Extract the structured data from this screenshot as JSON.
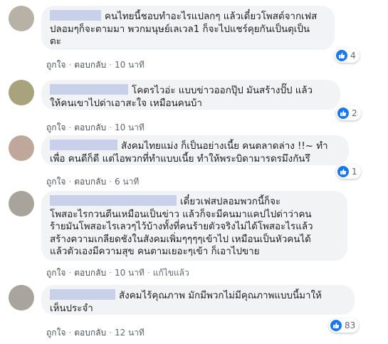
{
  "colors": {
    "like_blue": "#1877f2",
    "bubble_bg": "#f2f3f5",
    "redacted_name": "#c9d1ea"
  },
  "comments": [
    {
      "text_lines": [
        "คนไทยนี้ชอบทำอะไรแปลกๆ แล้วเดี๋ยวโพสต์จากเฟส",
        "ปลอมๆก็จะตามมา พวกมนุษย์เลเวล1 ก็จะไปแชร์คุยกันเป็นตุเป็น",
        "ตะ"
      ],
      "like_label": "ถูกใจ",
      "reply_label": "ตอบกลับ",
      "time": "10 นาที",
      "reaction_count": "4"
    },
    {
      "text_lines": [
        "โคตรไวอ่ะ แบบข่าวออกปุ๊ป มันสร้างปั๊ป แล้ว",
        "ให้คนเขาไปด่าเอาสะใจ เหมือนคนบ้า"
      ],
      "like_label": "ถูกใจ",
      "reply_label": "ตอบกลับ",
      "time": "10 นาที",
      "reaction_count": "2"
    },
    {
      "text_lines": [
        "สังคมไทยแม่ง ก็เป็นอย่างเนี้ย คนตลาดล่าง !!~ ทำ",
        "เพื่อ คนดีก็ดี แต่ไอพวกที่ทำแบบเนี้ย ทำให้พระบิดามารดรมึงกันรึ"
      ],
      "like_label": "ถูกใจ",
      "reply_label": "ตอบกลับ",
      "time": "6 นาที",
      "reaction_count": "1"
    },
    {
      "text_lines": [
        "เดี๋ยวเฟสปลอมพวกนี้ก็จะ",
        "โพสอะไรกวนตีนเหมือนเป็นข่าว แล้วก็จะมีคนมาแคปไปด่าว่าคน",
        "ร้ายมันโพสอะไรเลวๆไว้บ้างทั้งที่คนร้ายตัวจริงไม่ได้โพสอะไรแล้ว",
        "สร้างความเกลียดชังในสังคมเพิ่มๆๆๆๆเข้าไป เหมือนเป็นหัวคนได้",
        "แล้วตัวเองมีความสุข คนตามเยอะๆเข้า ก็เอาไปขาย"
      ],
      "like_label": "ถูกใจ",
      "reply_label": "ตอบกลับ",
      "time": "10 นาที",
      "edited_label": "แก้ไขแล้ว"
    },
    {
      "text_lines": [
        "สังคมไร้คุณภาพ มักมีพวกไม่มีคุณภาพแบบนี้มาให้",
        "เห็นประจำ"
      ],
      "like_label": "ถูกใจ",
      "reply_label": "ตอบกลับ",
      "time": "12 นาที",
      "reaction_count": "83"
    }
  ]
}
